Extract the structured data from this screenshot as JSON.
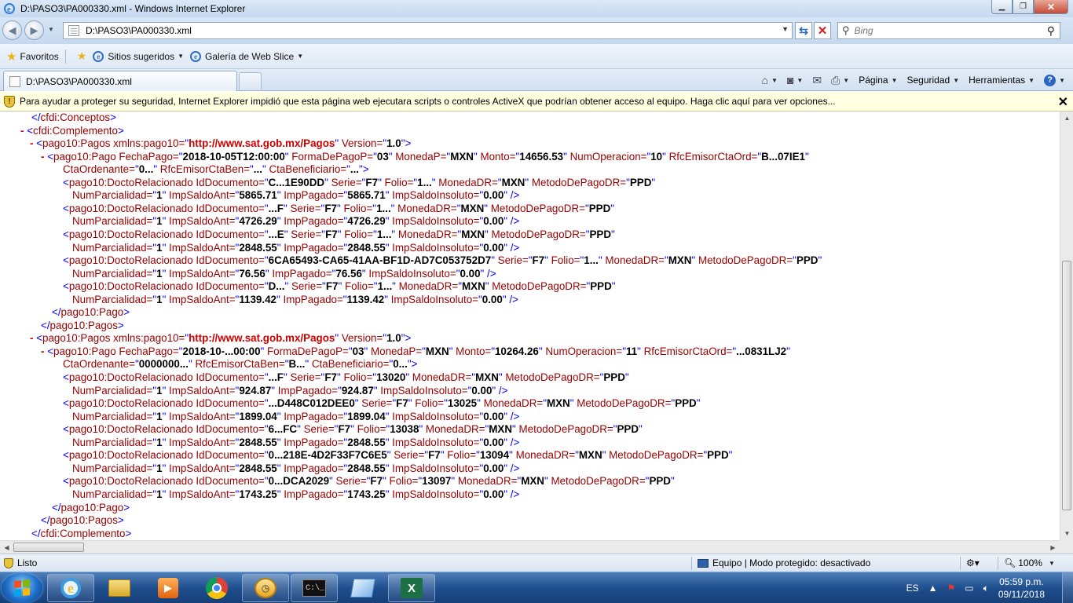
{
  "window": {
    "title": "D:\\PASO3\\PA000330.xml - Windows Internet Explorer"
  },
  "address": {
    "url": "D:\\PASO3\\PA000330.xml",
    "search_placeholder": "Bing"
  },
  "favorites_bar": {
    "favorites_label": "Favoritos",
    "suggested_sites": "Sitios sugeridos",
    "web_slice_gallery": "Galería de Web Slice"
  },
  "tab": {
    "label": "D:\\PASO3\\PA000330.xml"
  },
  "command_bar": {
    "page": "Página",
    "security": "Seguridad",
    "tools": "Herramientas"
  },
  "infobar": {
    "message": "Para ayudar a proteger su seguridad, Internet Explorer impidió que esta página web ejecutara scripts o controles ActiveX que podrían obtener acceso al equipo. Haga clic aquí para ver opciones..."
  },
  "xml": {
    "namespace": "http://www.sat.gob.mx/Pagos",
    "version": "1.0",
    "pagos": [
      {
        "pago": {
          "fecha_pago": "2018-10-05T12:00:00",
          "forma_de_pago": "03",
          "moneda": "MXN",
          "monto": "14656.53",
          "num_operacion": "10",
          "rfc_emisor_cta_ord": "B...07IE1",
          "cta_ordenante": "0...",
          "rfc_emisor_cta_ben": "...",
          "cta_beneficiario": "..."
        },
        "doctos": [
          {
            "id": "C...1E90DD",
            "serie": "F7",
            "folio": "1...",
            "moneda_dr": "MXN",
            "metodo": "PPD",
            "parcialidad": "1",
            "saldo_ant": "5865.71",
            "pagado": "5865.71",
            "insoluto": "0.00"
          },
          {
            "id": "...F",
            "serie": "F7",
            "folio": "1...",
            "moneda_dr": "MXN",
            "metodo": "PPD",
            "parcialidad": "1",
            "saldo_ant": "4726.29",
            "pagado": "4726.29",
            "insoluto": "0.00"
          },
          {
            "id": "...E",
            "serie": "F7",
            "folio": "1...",
            "moneda_dr": "MXN",
            "metodo": "PPD",
            "parcialidad": "1",
            "saldo_ant": "2848.55",
            "pagado": "2848.55",
            "insoluto": "0.00"
          },
          {
            "id": "6CA65493-CA65-41AA-BF1D-AD7C053752D7",
            "serie": "F7",
            "folio": "1...",
            "moneda_dr": "MXN",
            "metodo": "PPD",
            "parcialidad": "1",
            "saldo_ant": "76.56",
            "pagado": "76.56",
            "insoluto": "0.00"
          },
          {
            "id": "D...",
            "serie": "F7",
            "folio": "1...",
            "moneda_dr": "MXN",
            "metodo": "PPD",
            "parcialidad": "1",
            "saldo_ant": "1139.42",
            "pagado": "1139.42",
            "insoluto": "0.00"
          }
        ]
      },
      {
        "pago": {
          "fecha_pago": "2018-10-...00:00",
          "forma_de_pago": "03",
          "moneda": "MXN",
          "monto": "10264.26",
          "num_operacion": "11",
          "rfc_emisor_cta_ord": "...0831LJ2",
          "cta_ordenante": "0000000...",
          "rfc_emisor_cta_ben": "B...",
          "cta_beneficiario": "0..."
        },
        "doctos": [
          {
            "id": "...F",
            "serie": "F7",
            "folio": "13020",
            "moneda_dr": "MXN",
            "metodo": "PPD",
            "parcialidad": "1",
            "saldo_ant": "924.87",
            "pagado": "924.87",
            "insoluto": "0.00"
          },
          {
            "id": "...D448C012DEE0",
            "serie": "F7",
            "folio": "13025",
            "moneda_dr": "MXN",
            "metodo": "PPD",
            "parcialidad": "1",
            "saldo_ant": "1899.04",
            "pagado": "1899.04",
            "insoluto": "0.00"
          },
          {
            "id": "6...FC",
            "serie": "F7",
            "folio": "13038",
            "moneda_dr": "MXN",
            "metodo": "PPD",
            "parcialidad": "1",
            "saldo_ant": "2848.55",
            "pagado": "2848.55",
            "insoluto": "0.00"
          },
          {
            "id": "0...218E-4D2F33F7C6E5",
            "serie": "F7",
            "folio": "13094",
            "moneda_dr": "MXN",
            "metodo": "PPD",
            "parcialidad": "1",
            "saldo_ant": "2848.55",
            "pagado": "2848.55",
            "insoluto": "0.00"
          },
          {
            "id": "0...DCA2029",
            "serie": "F7",
            "folio": "13097",
            "moneda_dr": "MXN",
            "metodo": "PPD",
            "parcialidad": "1",
            "saldo_ant": "1743.25",
            "pagado": "1743.25",
            "insoluto": "0.00"
          }
        ]
      }
    ]
  },
  "statusbar": {
    "status": "Listo",
    "zone": "Equipo | Modo protegido: desactivado",
    "zoom": "100%"
  },
  "taskbar": {
    "language": "ES",
    "time": "05:59 p.m.",
    "date": "09/11/2018"
  }
}
